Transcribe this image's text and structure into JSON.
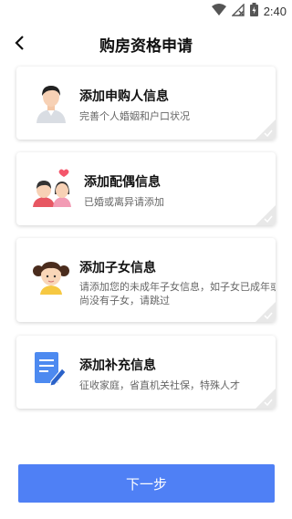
{
  "status_bar": {
    "time": "2:40"
  },
  "header": {
    "title": "购房资格申请"
  },
  "cards": [
    {
      "title": "添加申购人信息",
      "desc": "完善个人婚姻和户口状况"
    },
    {
      "title": "添加配偶信息",
      "desc": "已婚或离异请添加"
    },
    {
      "title": "添加子女信息",
      "desc_line1": "请添加您的未成年子女信息，如子女已成年或",
      "desc_line2": "尚没有子女，请跳过"
    },
    {
      "title": "添加补充信息",
      "desc": "征收家庭，省直机关社保，特殊人才"
    }
  ],
  "footer": {
    "next_label": "下一步"
  },
  "colors": {
    "accent": "#4f80f5"
  }
}
